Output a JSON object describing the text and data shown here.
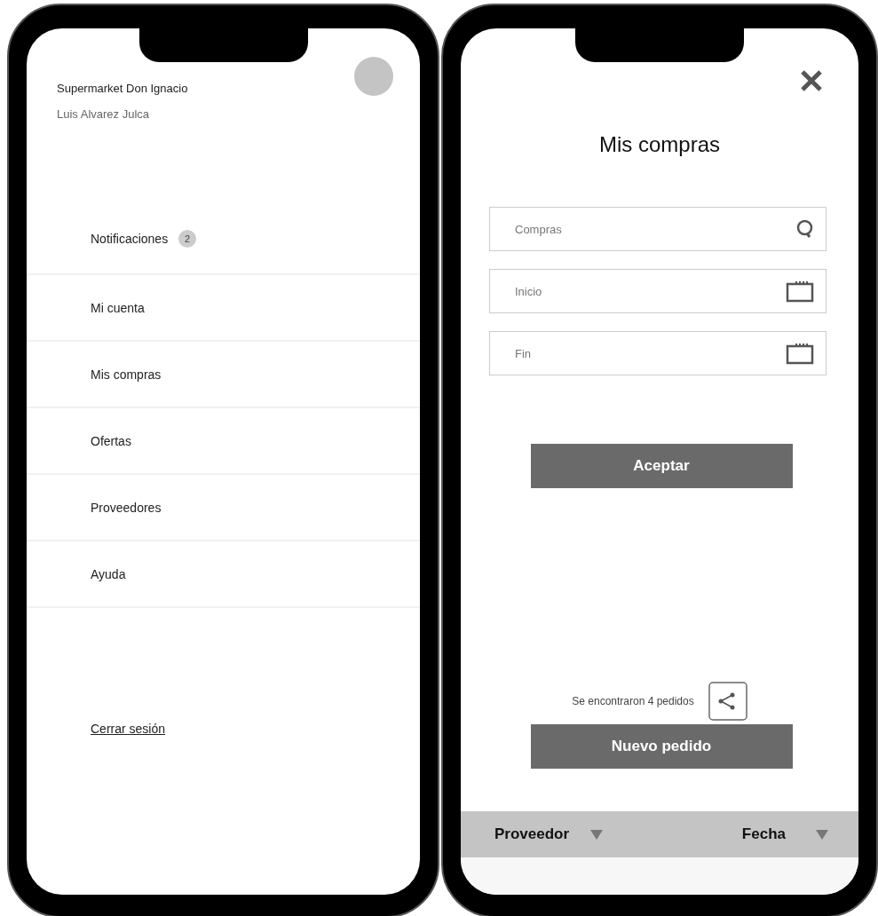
{
  "menu_panel": {
    "store_name": "Supermarket Don Ignacio",
    "user_name": "Luis Alvarez Julca",
    "items": [
      {
        "label": "Notificaciones",
        "badge": "2"
      },
      {
        "label": "Mi cuenta"
      },
      {
        "label": "Mis compras"
      },
      {
        "label": "Ofertas"
      },
      {
        "label": "Proveedores"
      },
      {
        "label": "Ayuda"
      }
    ],
    "logout_link": "Cerrar sesión"
  },
  "purchases_screen": {
    "title": "Mis compras",
    "fields": [
      {
        "placeholder": "Compras",
        "kind": "search"
      },
      {
        "placeholder": "Inicio",
        "kind": "date"
      },
      {
        "placeholder": "Fin",
        "kind": "date"
      }
    ],
    "accept_button": "Aceptar",
    "results_text": "Se encontraron 4 pedidos",
    "new_order_button": "Nuevo pedido",
    "table": {
      "columns": [
        "Proveedor",
        "Fecha"
      ]
    }
  }
}
